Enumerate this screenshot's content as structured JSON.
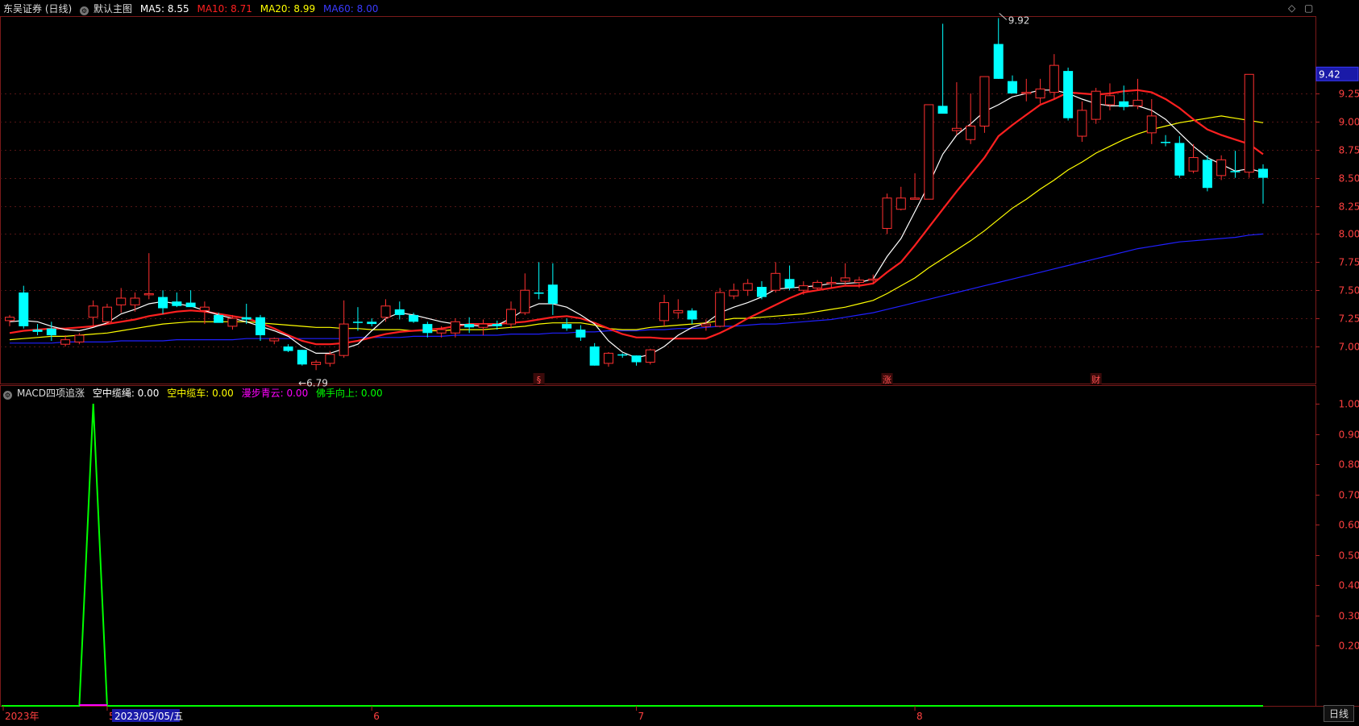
{
  "header": {
    "stock": "东吴证券 (日线)",
    "template": "默认主图",
    "ma": [
      {
        "label": "MA5: 8.55",
        "color": "#ffffff"
      },
      {
        "label": "MA10: 8.71",
        "color": "#ff2020"
      },
      {
        "label": "MA20: 8.99",
        "color": "#ffff00"
      },
      {
        "label": "MA60: 8.00",
        "color": "#3a3aff"
      }
    ]
  },
  "sub_header": {
    "indicator": "MACD四项追涨",
    "items": [
      {
        "label": "空中缆绳: 0.00",
        "color": "#ffffff"
      },
      {
        "label": "空中缆车: 0.00",
        "color": "#ffff00"
      },
      {
        "label": "漫步青云: 0.00",
        "color": "#ff00ff"
      },
      {
        "label": "佛手向上: 0.00",
        "color": "#00ff00"
      }
    ]
  },
  "markers": {
    "high_label": "9.92",
    "low_label": "6.79",
    "current_price": "9.42",
    "event_marks": [
      {
        "text": "§",
        "index": 38
      },
      {
        "text": "涨",
        "index": 63
      },
      {
        "text": "财",
        "index": 78
      }
    ]
  },
  "bottom_axis": {
    "labels": [
      {
        "text": "2023年",
        "index": 1
      },
      {
        "text": "5",
        "index": 7
      },
      {
        "text": "6",
        "index": 26
      },
      {
        "text": "7",
        "index": 45
      },
      {
        "text": "8",
        "index": 65
      }
    ],
    "date_readout": "2023/05/05/五",
    "date_readout_index": 7,
    "tab": "日线"
  },
  "chart_data": [
    {
      "type": "candlestick",
      "title": "",
      "ylim": [
        6.7,
        10.05
      ],
      "yticks": [
        {
          "value": 9.25,
          "label": "9.25"
        },
        {
          "value": 9.0,
          "label": "9.00"
        },
        {
          "value": 8.75,
          "label": "8.75"
        },
        {
          "value": 8.5,
          "label": "8.50"
        },
        {
          "value": 8.25,
          "label": "8.25"
        },
        {
          "value": 8.0,
          "label": "8.00"
        },
        {
          "value": 7.75,
          "label": "7.75"
        },
        {
          "value": 7.5,
          "label": "7.50"
        },
        {
          "value": 7.25,
          "label": "7.25"
        },
        {
          "value": 7.0,
          "label": "7.00"
        }
      ],
      "colors": {
        "up": "#ff3030",
        "down": "#00ffff",
        "ma5": "#ffffff",
        "ma10": "#ff2020",
        "ma20": "#ffff00",
        "ma60": "#2020ff",
        "grid": "#551515"
      },
      "ohlc": [
        [
          7.23,
          7.28,
          7.18,
          7.26
        ],
        [
          7.48,
          7.54,
          7.16,
          7.18
        ],
        [
          7.15,
          7.2,
          7.1,
          7.13
        ],
        [
          7.16,
          7.22,
          7.05,
          7.1
        ],
        [
          7.02,
          7.1,
          7.0,
          7.06
        ],
        [
          7.04,
          7.12,
          7.02,
          7.1
        ],
        [
          7.26,
          7.41,
          7.18,
          7.36
        ],
        [
          7.22,
          7.38,
          7.2,
          7.35
        ],
        [
          7.37,
          7.52,
          7.3,
          7.43
        ],
        [
          7.37,
          7.48,
          7.31,
          7.43
        ],
        [
          7.46,
          7.83,
          7.42,
          7.47
        ],
        [
          7.44,
          7.5,
          7.29,
          7.34
        ],
        [
          7.4,
          7.48,
          7.35,
          7.36
        ],
        [
          7.39,
          7.5,
          7.36,
          7.35
        ],
        [
          7.32,
          7.4,
          7.2,
          7.35
        ],
        [
          7.28,
          7.3,
          7.24,
          7.21
        ],
        [
          7.18,
          7.28,
          7.15,
          7.25
        ],
        [
          7.26,
          7.38,
          7.2,
          7.24
        ],
        [
          7.26,
          7.28,
          7.05,
          7.1
        ],
        [
          7.05,
          7.08,
          7.02,
          7.07
        ],
        [
          7.0,
          7.02,
          6.95,
          6.96
        ],
        [
          6.97,
          6.97,
          6.83,
          6.84
        ],
        [
          6.84,
          6.88,
          6.79,
          6.86
        ],
        [
          6.85,
          6.96,
          6.82,
          6.93
        ],
        [
          6.92,
          7.41,
          6.9,
          7.2
        ],
        [
          7.22,
          7.35,
          7.14,
          7.21
        ],
        [
          7.22,
          7.25,
          7.18,
          7.2
        ],
        [
          7.26,
          7.42,
          7.22,
          7.36
        ],
        [
          7.33,
          7.4,
          7.24,
          7.28
        ],
        [
          7.28,
          7.3,
          7.21,
          7.22
        ],
        [
          7.2,
          7.22,
          7.08,
          7.12
        ],
        [
          7.12,
          7.18,
          7.08,
          7.15
        ],
        [
          7.12,
          7.25,
          7.08,
          7.22
        ],
        [
          7.2,
          7.26,
          7.12,
          7.17
        ],
        [
          7.17,
          7.24,
          7.1,
          7.2
        ],
        [
          7.2,
          7.23,
          7.15,
          7.18
        ],
        [
          7.2,
          7.4,
          7.16,
          7.33
        ],
        [
          7.3,
          7.65,
          7.28,
          7.5
        ],
        [
          7.48,
          7.75,
          7.42,
          7.47
        ],
        [
          7.55,
          7.74,
          7.28,
          7.38
        ],
        [
          7.2,
          7.25,
          7.14,
          7.16
        ],
        [
          7.15,
          7.19,
          7.05,
          7.08
        ],
        [
          7.0,
          7.03,
          6.83,
          6.83
        ],
        [
          6.85,
          6.95,
          6.82,
          6.94
        ],
        [
          6.93,
          6.94,
          6.9,
          6.92
        ],
        [
          6.92,
          6.92,
          6.83,
          6.86
        ],
        [
          6.86,
          6.98,
          6.84,
          6.97
        ],
        [
          7.23,
          7.46,
          7.18,
          7.39
        ],
        [
          7.3,
          7.42,
          7.25,
          7.32
        ],
        [
          7.32,
          7.34,
          7.2,
          7.24
        ],
        [
          7.18,
          7.24,
          7.14,
          7.2
        ],
        [
          7.18,
          7.52,
          7.17,
          7.48
        ],
        [
          7.45,
          7.56,
          7.42,
          7.5
        ],
        [
          7.5,
          7.6,
          7.45,
          7.56
        ],
        [
          7.53,
          7.58,
          7.42,
          7.44
        ],
        [
          7.5,
          7.75,
          7.48,
          7.65
        ],
        [
          7.6,
          7.72,
          7.5,
          7.52
        ],
        [
          7.5,
          7.58,
          7.46,
          7.54
        ],
        [
          7.52,
          7.59,
          7.5,
          7.57
        ],
        [
          7.56,
          7.62,
          7.52,
          7.57
        ],
        [
          7.58,
          7.74,
          7.55,
          7.61
        ],
        [
          7.57,
          7.62,
          7.52,
          7.59
        ],
        [
          7.59,
          7.64,
          7.56,
          7.6
        ],
        [
          8.05,
          8.36,
          8.0,
          8.32
        ],
        [
          8.22,
          8.42,
          8.21,
          8.32
        ],
        [
          8.32,
          8.54,
          8.31,
          8.32
        ],
        [
          8.31,
          9.15,
          8.31,
          9.15
        ],
        [
          9.14,
          9.87,
          9.08,
          9.07
        ],
        [
          8.92,
          9.35,
          8.88,
          8.94
        ],
        [
          8.84,
          9.25,
          8.8,
          8.96
        ],
        [
          8.96,
          9.4,
          8.9,
          9.4
        ],
        [
          9.69,
          9.92,
          9.38,
          9.38
        ],
        [
          9.36,
          9.41,
          9.25,
          9.25
        ],
        [
          9.25,
          9.38,
          9.18,
          9.26
        ],
        [
          9.21,
          9.38,
          9.16,
          9.29
        ],
        [
          9.26,
          9.6,
          9.2,
          9.5
        ],
        [
          9.45,
          9.48,
          9.01,
          9.03
        ],
        [
          8.87,
          9.18,
          8.82,
          9.1
        ],
        [
          9.02,
          9.3,
          8.98,
          9.27
        ],
        [
          9.15,
          9.34,
          9.1,
          9.23
        ],
        [
          9.18,
          9.32,
          9.1,
          9.13
        ],
        [
          9.14,
          9.38,
          9.11,
          9.19
        ],
        [
          8.9,
          9.2,
          8.8,
          9.05
        ],
        [
          8.82,
          8.88,
          8.78,
          8.81
        ],
        [
          8.81,
          8.87,
          8.5,
          8.52
        ],
        [
          8.56,
          8.8,
          8.54,
          8.68
        ],
        [
          8.66,
          8.7,
          8.38,
          8.41
        ],
        [
          8.52,
          8.7,
          8.48,
          8.66
        ],
        [
          8.56,
          8.74,
          8.5,
          8.55
        ],
        [
          8.55,
          9.42,
          8.5,
          9.42
        ],
        [
          8.58,
          8.62,
          8.27,
          8.5
        ]
      ],
      "ma5": [
        7.22,
        7.23,
        7.22,
        7.18,
        7.15,
        7.14,
        7.17,
        7.21,
        7.29,
        7.33,
        7.38,
        7.4,
        7.38,
        7.36,
        7.32,
        7.28,
        7.25,
        7.22,
        7.18,
        7.14,
        7.09,
        7.0,
        6.94,
        6.94,
        6.98,
        7.02,
        7.14,
        7.25,
        7.3,
        7.28,
        7.25,
        7.22,
        7.2,
        7.19,
        7.18,
        7.19,
        7.25,
        7.33,
        7.38,
        7.38,
        7.35,
        7.28,
        7.2,
        7.05,
        6.95,
        6.9,
        6.93,
        7.0,
        7.1,
        7.17,
        7.21,
        7.3,
        7.35,
        7.39,
        7.44,
        7.51,
        7.52,
        7.53,
        7.54,
        7.56,
        7.56,
        7.57,
        7.6,
        7.8,
        7.96,
        8.2,
        8.44,
        8.71,
        8.88,
        8.98,
        9.09,
        9.15,
        9.22,
        9.25,
        9.28,
        9.28,
        9.25,
        9.2,
        9.16,
        9.14,
        9.14,
        9.14,
        9.1,
        9.02,
        8.9,
        8.78,
        8.68,
        8.62,
        8.56,
        8.58,
        8.55
      ],
      "ma10": [
        7.12,
        7.14,
        7.15,
        7.16,
        7.16,
        7.17,
        7.18,
        7.2,
        7.22,
        7.24,
        7.27,
        7.29,
        7.31,
        7.32,
        7.31,
        7.29,
        7.27,
        7.25,
        7.21,
        7.16,
        7.1,
        7.05,
        7.02,
        7.02,
        7.03,
        7.05,
        7.08,
        7.11,
        7.13,
        7.14,
        7.15,
        7.16,
        7.18,
        7.2,
        7.2,
        7.2,
        7.21,
        7.22,
        7.24,
        7.26,
        7.27,
        7.25,
        7.21,
        7.16,
        7.11,
        7.08,
        7.08,
        7.07,
        7.07,
        7.07,
        7.07,
        7.12,
        7.18,
        7.25,
        7.31,
        7.37,
        7.43,
        7.48,
        7.5,
        7.52,
        7.54,
        7.54,
        7.56,
        7.66,
        7.75,
        7.9,
        8.06,
        8.22,
        8.38,
        8.53,
        8.68,
        8.87,
        8.97,
        9.06,
        9.15,
        9.2,
        9.26,
        9.25,
        9.24,
        9.25,
        9.27,
        9.28,
        9.26,
        9.2,
        9.12,
        9.02,
        8.93,
        8.88,
        8.84,
        8.8,
        8.71
      ],
      "ma20": [
        7.06,
        7.07,
        7.08,
        7.09,
        7.09,
        7.1,
        7.11,
        7.12,
        7.14,
        7.16,
        7.18,
        7.2,
        7.21,
        7.22,
        7.22,
        7.22,
        7.22,
        7.22,
        7.21,
        7.2,
        7.19,
        7.18,
        7.17,
        7.17,
        7.16,
        7.16,
        7.15,
        7.15,
        7.15,
        7.14,
        7.14,
        7.14,
        7.15,
        7.15,
        7.15,
        7.16,
        7.17,
        7.18,
        7.2,
        7.21,
        7.21,
        7.21,
        7.19,
        7.16,
        7.15,
        7.15,
        7.17,
        7.18,
        7.19,
        7.2,
        7.21,
        7.23,
        7.25,
        7.25,
        7.26,
        7.27,
        7.28,
        7.29,
        7.31,
        7.33,
        7.35,
        7.38,
        7.41,
        7.47,
        7.54,
        7.61,
        7.7,
        7.78,
        7.86,
        7.94,
        8.03,
        8.13,
        8.23,
        8.31,
        8.4,
        8.48,
        8.57,
        8.64,
        8.72,
        8.78,
        8.84,
        8.89,
        8.93,
        8.96,
        8.99,
        9.01,
        9.03,
        9.05,
        9.03,
        9.01,
        8.99
      ],
      "ma60": [
        7.03,
        7.03,
        7.03,
        7.03,
        7.04,
        7.04,
        7.04,
        7.04,
        7.05,
        7.05,
        7.05,
        7.05,
        7.06,
        7.06,
        7.06,
        7.06,
        7.06,
        7.07,
        7.07,
        7.07,
        7.07,
        7.07,
        7.07,
        7.07,
        7.07,
        7.08,
        7.08,
        7.08,
        7.08,
        7.09,
        7.09,
        7.09,
        7.1,
        7.1,
        7.1,
        7.1,
        7.11,
        7.11,
        7.11,
        7.12,
        7.12,
        7.13,
        7.13,
        7.14,
        7.14,
        7.14,
        7.15,
        7.15,
        7.16,
        7.16,
        7.17,
        7.18,
        7.18,
        7.19,
        7.2,
        7.2,
        7.21,
        7.22,
        7.23,
        7.24,
        7.26,
        7.28,
        7.3,
        7.33,
        7.36,
        7.39,
        7.42,
        7.45,
        7.48,
        7.51,
        7.54,
        7.57,
        7.6,
        7.63,
        7.66,
        7.69,
        7.72,
        7.75,
        7.78,
        7.81,
        7.84,
        7.87,
        7.89,
        7.91,
        7.93,
        7.94,
        7.95,
        7.96,
        7.97,
        7.99,
        8.0
      ]
    },
    {
      "type": "line",
      "title": "",
      "ylim": [
        0,
        1.06
      ],
      "yticks": [
        {
          "value": 1.0,
          "label": "1.00"
        },
        {
          "value": 0.9,
          "label": "0.90"
        },
        {
          "value": 0.8,
          "label": "0.80"
        },
        {
          "value": 0.7,
          "label": "0.70"
        },
        {
          "value": 0.6,
          "label": "0.60"
        },
        {
          "value": 0.5,
          "label": "0.50"
        },
        {
          "value": 0.4,
          "label": "0.40"
        },
        {
          "value": 0.3,
          "label": "0.30"
        },
        {
          "value": 0.2,
          "label": "0.20"
        }
      ],
      "series": [
        {
          "color": "#00ff00",
          "spike": {
            "index": 6,
            "value": 1.0
          }
        },
        {
          "color": "#ff00ff",
          "spike": {
            "index": 6,
            "value": 0.0
          }
        }
      ]
    }
  ]
}
